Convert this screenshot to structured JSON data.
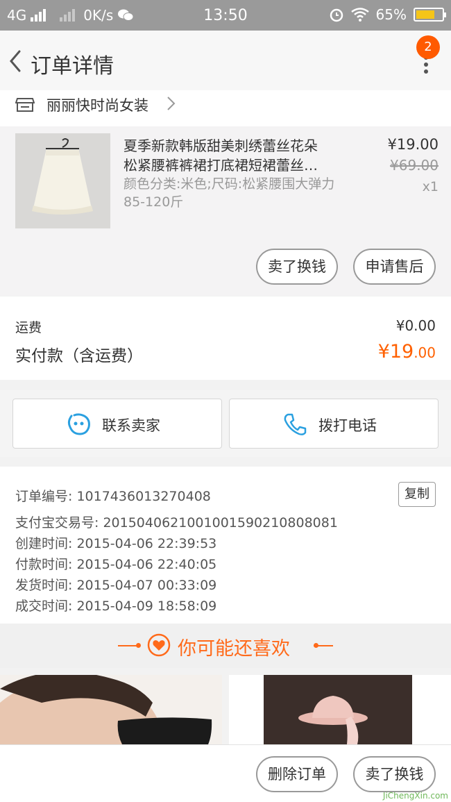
{
  "status_bar": {
    "network": "4G",
    "speed": "0K/s",
    "time": "13:50",
    "battery": "65%"
  },
  "header": {
    "title": "订单详情",
    "badge_count": "2"
  },
  "shop": {
    "name": "丽丽快时尚女装"
  },
  "product": {
    "title_line1": "夏季新款韩版甜美刺绣蕾丝花朵",
    "title_line2": "松紧腰裤裤裙打底裙短裙蕾丝…",
    "spec": "颜色分类:米色;尺码:松紧腰围大弹力85-120斤",
    "price": "¥19.00",
    "original_price": "¥69.00",
    "quantity": "x1",
    "sell_button": "卖了换钱",
    "after_sale_button": "申请售后"
  },
  "fees": {
    "shipping_label": "运费",
    "shipping_value": "¥0.00",
    "paid_label": "实付款（含运费）",
    "paid_currency_int": "¥19",
    "paid_decimal": ".00"
  },
  "contact": {
    "seller_label": "联系卖家",
    "call_label": "拨打电话"
  },
  "order_info": {
    "order_no_label": "订单编号:",
    "order_no": "1017436013270408",
    "alipay_label": "支付宝交易号:",
    "alipay_no": "2015040621001001590210808081",
    "created_label": "创建时间:",
    "created": "2015-04-06 22:39:53",
    "paid_label": "付款时间:",
    "paid": "2015-04-06 22:40:05",
    "shipped_label": "发货时间:",
    "shipped": "2015-04-07 00:33:09",
    "done_label": "成交时间:",
    "done": "2015-04-09 18:58:09",
    "copy_button": "复制"
  },
  "recommend": {
    "title": "你可能还喜欢"
  },
  "bottom_bar": {
    "delete_button": "删除订单",
    "sell_button": "卖了换钱"
  },
  "watermark": "JiChengXin.com",
  "colors": {
    "accent": "#ff6000",
    "icon_blue": "#2aa0e0"
  }
}
